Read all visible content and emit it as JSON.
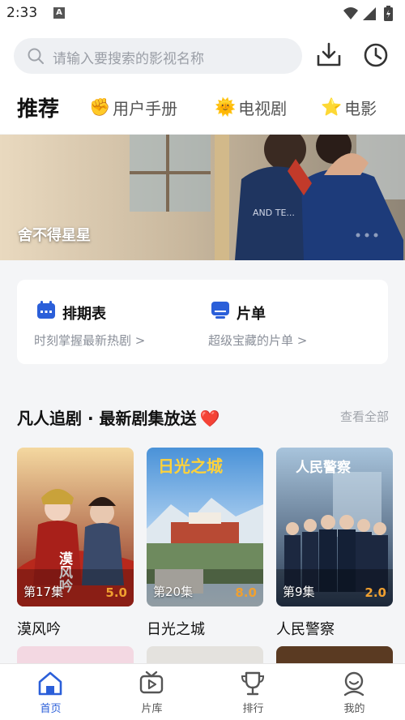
{
  "status_bar": {
    "time": "2:33",
    "notification_glyph": "A"
  },
  "search": {
    "placeholder": "请输入要搜索的影视名称"
  },
  "tabs": [
    {
      "label": "推荐",
      "emoji": ""
    },
    {
      "label": "用户手册",
      "emoji": "✊"
    },
    {
      "label": "电视剧",
      "emoji": "🌞"
    },
    {
      "label": "电影",
      "emoji": "⭐"
    }
  ],
  "banner": {
    "title": "舍不得星星"
  },
  "quick_links": [
    {
      "title": "排期表",
      "subtitle": "时刻掌握最新热剧 >"
    },
    {
      "title": "片单",
      "subtitle": "超级宝藏的片单 >"
    }
  ],
  "section": {
    "title": "凡人追剧 · 最新剧集放送",
    "heart": "❤️",
    "more": "查看全部"
  },
  "shows": [
    {
      "title": "漠风吟",
      "episode": "第17集",
      "score": "5.0",
      "poster_text": "漠风吟"
    },
    {
      "title": "日光之城",
      "episode": "第20集",
      "score": "8.0",
      "poster_text": "日光之城"
    },
    {
      "title": "人民警察",
      "episode": "第9集",
      "score": "2.0",
      "poster_text": "人民警察"
    }
  ],
  "bottom_nav": [
    {
      "label": "首页"
    },
    {
      "label": "片库"
    },
    {
      "label": "排行"
    },
    {
      "label": "我的"
    }
  ],
  "colors": {
    "accent": "#2b5fd9",
    "score": "#f0a030",
    "heart": "#e02030"
  }
}
